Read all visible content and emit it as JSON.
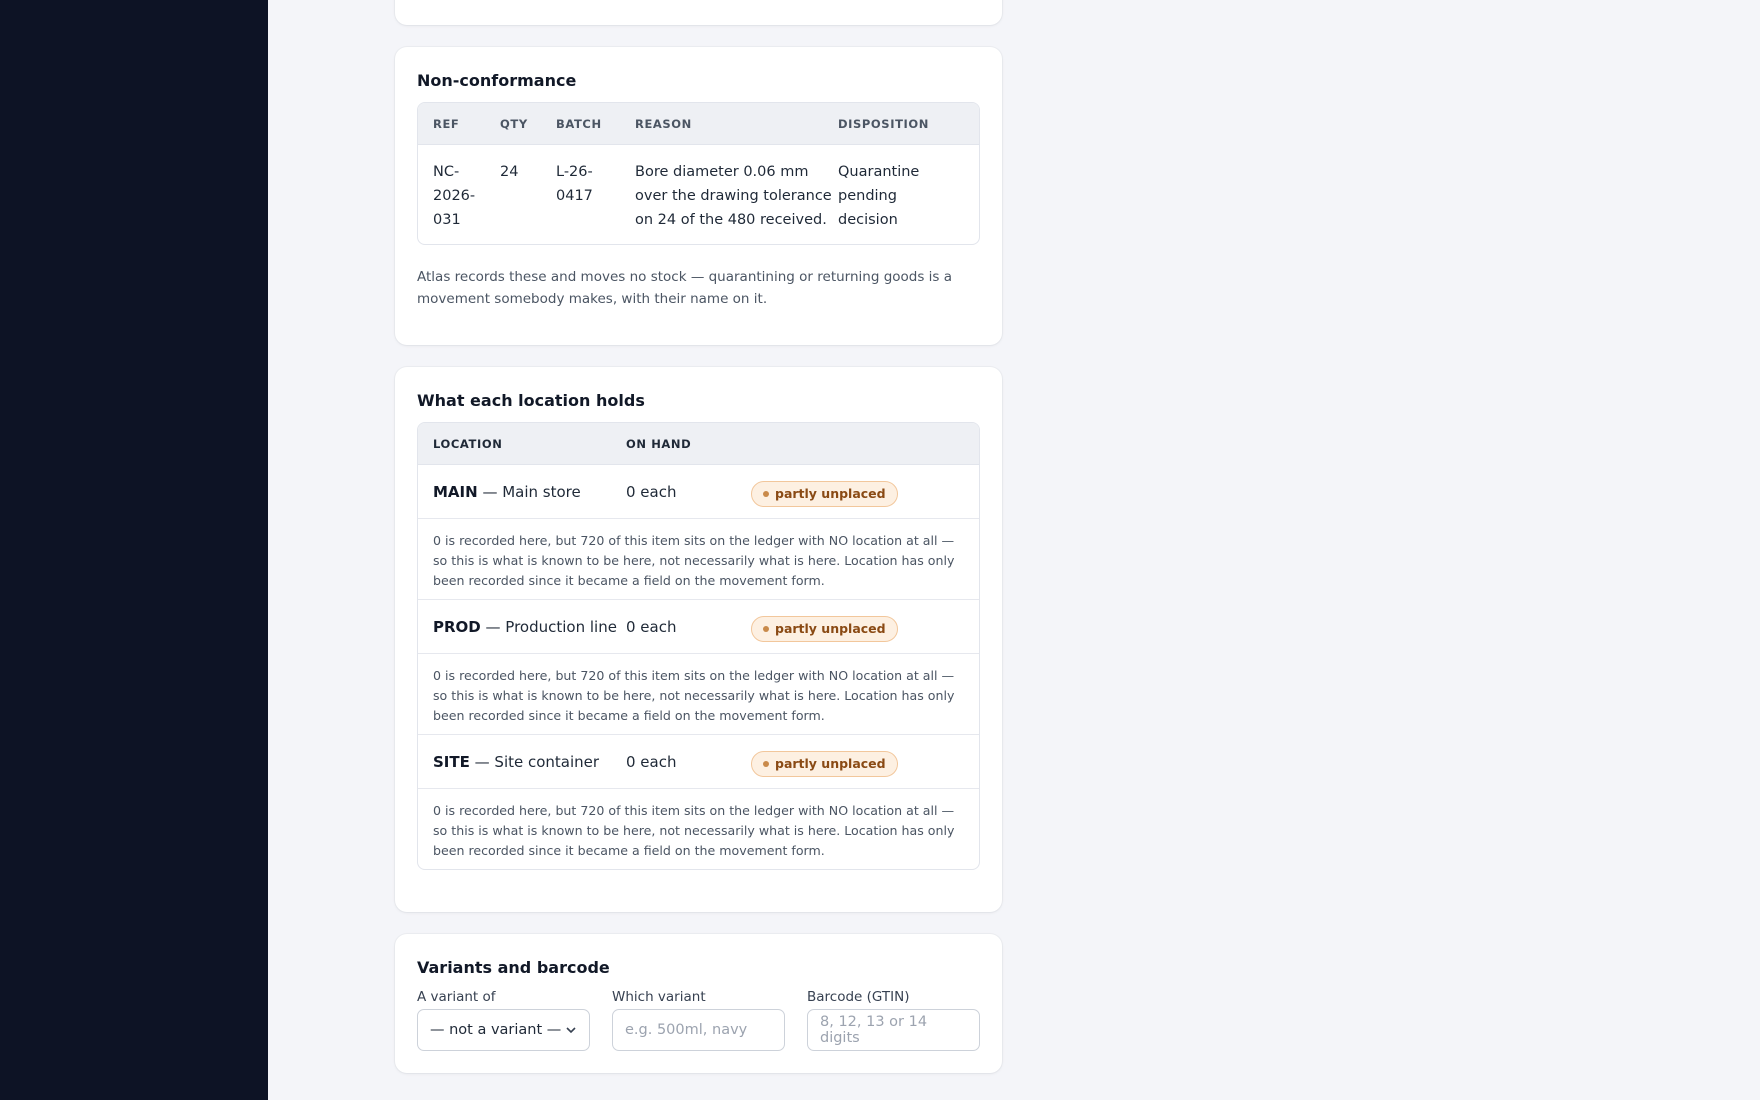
{
  "nonconformance": {
    "title": "Non-conformance",
    "columns": [
      "REF",
      "QTY",
      "BATCH",
      "REASON",
      "DISPOSITION"
    ],
    "rows": [
      {
        "ref": "NC-2026-031",
        "qty": "24",
        "batch": "L-26-0417",
        "reason": "Bore diameter 0.06 mm over the drawing tolerance on 24 of the 480 received.",
        "disposition": "Quarantine pending decision"
      }
    ],
    "note": "Atlas records these and moves no stock — quarantining or returning goods is a movement somebody makes, with their name on it."
  },
  "locations": {
    "title": "What each location holds",
    "columns": [
      "LOCATION",
      "ON HAND"
    ],
    "rows": [
      {
        "code": "MAIN",
        "name": "— Main store",
        "on_hand": "0 each",
        "badge": "partly unplaced",
        "detail": "0 is recorded here, but 720 of this item sits on the ledger with NO location at all — so this is what is known to be here, not necessarily what is here. Location has only been recorded since it became a field on the movement form."
      },
      {
        "code": "PROD",
        "name": "— Production line",
        "on_hand": "0 each",
        "badge": "partly unplaced",
        "detail": "0 is recorded here, but 720 of this item sits on the ledger with NO location at all — so this is what is known to be here, not necessarily what is here. Location has only been recorded since it became a field on the movement form."
      },
      {
        "code": "SITE",
        "name": "— Site container",
        "on_hand": "0 each",
        "badge": "partly unplaced",
        "detail": "0 is recorded here, but 720 of this item sits on the ledger with NO location at all — so this is what is known to be here, not necessarily what is here. Location has only been recorded since it became a field on the movement form."
      }
    ]
  },
  "variants": {
    "title": "Variants and barcode",
    "variant_of_label": "A variant of",
    "variant_of_value": "— not a variant —",
    "which_variant_label": "Which variant",
    "which_variant_placeholder": "e.g. 500ml, navy",
    "barcode_label": "Barcode (GTIN)",
    "barcode_placeholder": "8, 12, 13 or 14 digits"
  },
  "icons": {
    "select_caret": "chevron-down-icon",
    "status_dot": "dot-icon"
  },
  "colors": {
    "sidebar": "#0d1325",
    "badge_bg": "#fdf0e2",
    "badge_text": "#8a4a14"
  }
}
